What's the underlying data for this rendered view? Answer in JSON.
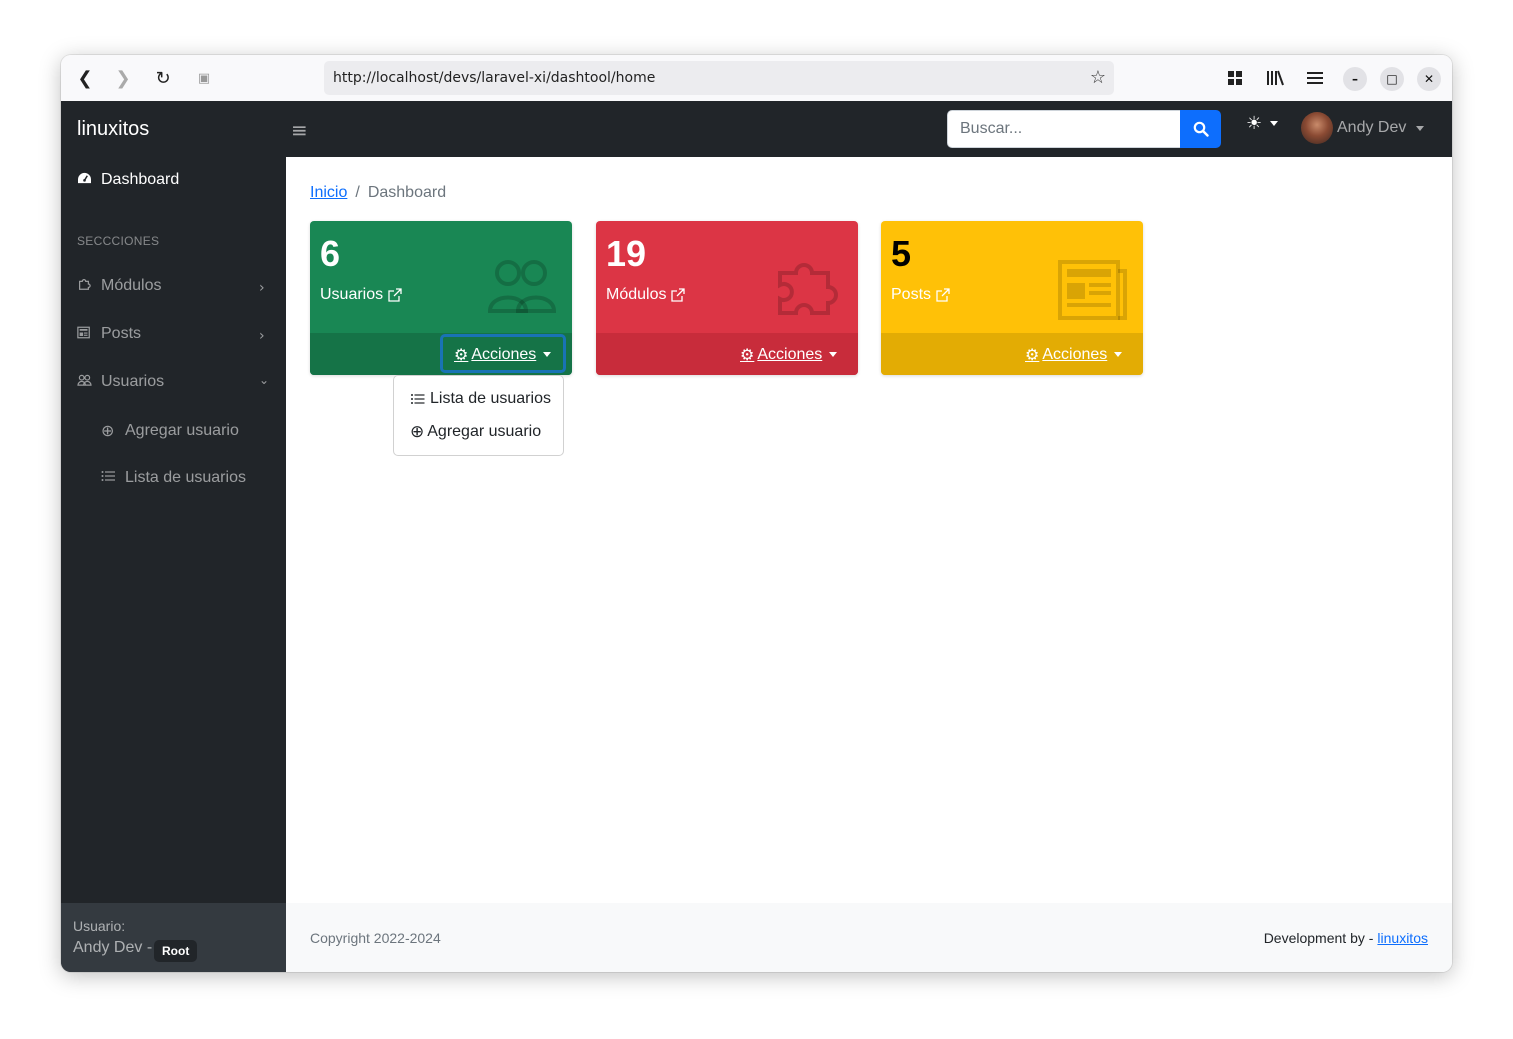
{
  "browser": {
    "url": "http://localhost/devs/laravel-xi/dashtool/home"
  },
  "brand": "linuxitos",
  "sidebar": {
    "dashboard_label": "Dashboard",
    "section_heading": "SECCCIONES",
    "items": [
      {
        "label": "Módulos"
      },
      {
        "label": "Posts"
      },
      {
        "label": "Usuarios"
      }
    ],
    "subitems": [
      {
        "label": "Agregar usuario"
      },
      {
        "label": "Lista de usuarios"
      }
    ],
    "user_caption": "Usuario:",
    "user_name": "Andy Dev -",
    "user_role": "Root"
  },
  "topbar": {
    "search_placeholder": "Buscar...",
    "user_name": "Andy Dev"
  },
  "breadcrumb": {
    "home": "Inicio",
    "separator": "/",
    "current": "Dashboard"
  },
  "cards": [
    {
      "count": "6",
      "label": "Usuarios",
      "action": "Acciones",
      "color": "#198754",
      "footer_color": "#157347"
    },
    {
      "count": "19",
      "label": "Módulos",
      "action": "Acciones",
      "color": "#dc3545",
      "footer_color": "#c82c3b"
    },
    {
      "count": "5",
      "label": "Posts",
      "action": "Acciones",
      "color": "#ffc107",
      "footer_color": "#e3ac04"
    }
  ],
  "dropdown": {
    "items": [
      {
        "label": "Lista de usuarios"
      },
      {
        "label": "Agregar usuario"
      }
    ]
  },
  "footer": {
    "copyright": "Copyright 2022-2024",
    "dev_prefix": "Development by -",
    "dev_link": "linuxitos"
  }
}
